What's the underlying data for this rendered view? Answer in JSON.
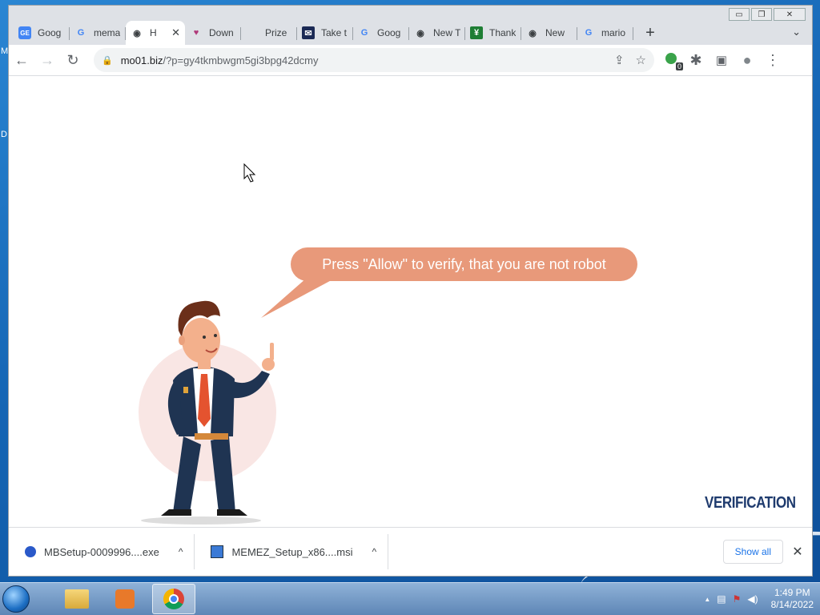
{
  "desktop": {
    "left_letters": [
      "M",
      "D"
    ]
  },
  "window_controls": {
    "minimize": "▭",
    "restore": "❐",
    "close": "✕"
  },
  "tabs": [
    {
      "label": "Goog",
      "icon": "google-earth-icon",
      "fav": "GE",
      "fav_color": "#4285f4"
    },
    {
      "label": "mema",
      "icon": "google-icon",
      "fav": "G",
      "fav_color": "#4285f4"
    },
    {
      "label": "H",
      "icon": "globe-icon",
      "fav": "◉",
      "fav_color": "#3c4043",
      "close": "✕"
    },
    {
      "label": "Down",
      "icon": "heart-icon",
      "fav": "♥",
      "fav_color": "#b03a7a"
    },
    {
      "label": "Prize",
      "icon": "blank-icon",
      "fav": "",
      "fav_color": "#fff"
    },
    {
      "label": "Take t",
      "icon": "mail-icon",
      "fav": "✉",
      "fav_color": "#1b2a55"
    },
    {
      "label": "Goog",
      "icon": "google-icon",
      "fav": "G",
      "fav_color": "#4285f4"
    },
    {
      "label": "New T",
      "icon": "chrome-icon",
      "fav": "◉",
      "fav_color": "#3c4043"
    },
    {
      "label": "Thank",
      "icon": "bookmark-icon",
      "fav": "¥",
      "fav_color": "#1e7e34"
    },
    {
      "label": "New",
      "icon": "chrome-icon",
      "fav": "◉",
      "fav_color": "#3c4043"
    },
    {
      "label": "mario",
      "icon": "google-icon",
      "fav": "G",
      "fav_color": "#4285f4"
    }
  ],
  "new_tab": "+",
  "tab_menu": "⌄",
  "toolbar": {
    "back": "←",
    "forward": "→",
    "reload": "↻",
    "lock": "🔒",
    "url_host": "mo01.biz",
    "url_path": "/?p=gy4tkmbwgm5gi3bpg42dcmy",
    "share": "⇪",
    "star": "☆",
    "ext_badge": "0",
    "puzzle": "✱",
    "sidepanel": "▣",
    "profile": "●",
    "menu": "⋮"
  },
  "page": {
    "bubble_text": "Press \"Allow\" to verify, that you are not robot",
    "verification": "VERIFICATION",
    "colors": {
      "bubble": "#e8997a",
      "verification": "#1f3b6e"
    }
  },
  "downloads": [
    {
      "name": "MBSetup-0009996....exe",
      "icon": "malwarebytes-icon"
    },
    {
      "name": "MEMEZ_Setup_x86....msi",
      "icon": "installer-icon"
    }
  ],
  "download_bar": {
    "show_all": "Show all",
    "close": "✕"
  },
  "taskbar": {
    "apps": [
      "explorer-icon",
      "media-player-icon",
      "chrome-icon"
    ],
    "tray_arrow": "▲",
    "time": "1:49 PM",
    "date": "8/14/2022"
  }
}
